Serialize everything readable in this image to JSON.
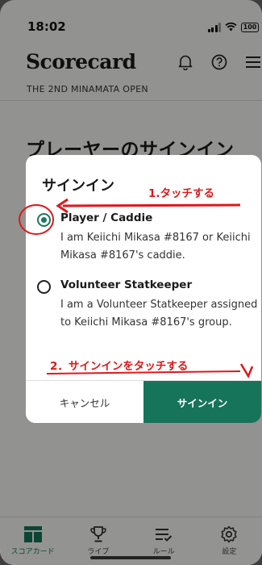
{
  "status": {
    "time": "18:02",
    "battery": "100"
  },
  "header": {
    "title": "Scorecard",
    "subtitle": "THE 2ND MINAMATA OPEN"
  },
  "page": {
    "title": "プレーヤーのサインイン"
  },
  "modal": {
    "title": "サインイン",
    "options": [
      {
        "title": "Player / Caddie",
        "desc": "I am Keiichi Mikasa #8167 or Keiichi Mikasa #8167's caddie.",
        "checked": true
      },
      {
        "title": "Volunteer Statkeeper",
        "desc": "I am a Volunteer Statkeeper assigned to Keiichi Mikasa #8167's group.",
        "checked": false
      }
    ],
    "cancel_label": "キャンセル",
    "signin_label": "サインイン"
  },
  "annotations": {
    "step1": "1.タッチする",
    "step2": "2．サインインをタッチする"
  },
  "tabs": [
    {
      "label": "スコアカード",
      "icon": "scorecard-icon",
      "active": true
    },
    {
      "label": "ライブ",
      "icon": "trophy-icon",
      "active": false
    },
    {
      "label": "ルール",
      "icon": "rules-icon",
      "active": false
    },
    {
      "label": "設定",
      "icon": "gear-icon",
      "active": false
    }
  ],
  "colors": {
    "accent": "#15745a",
    "annotation": "#e01818"
  }
}
